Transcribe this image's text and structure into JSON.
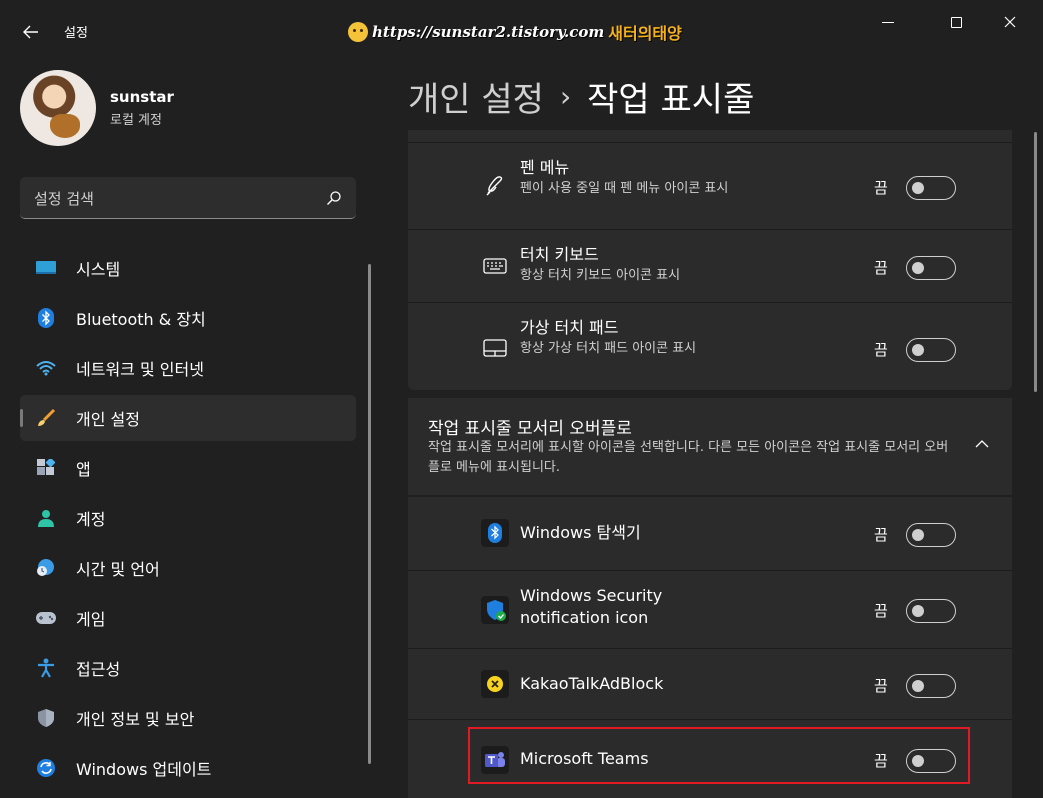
{
  "window": {
    "app_title": "설정",
    "watermark_url": "https://sunstar2.tistory.com",
    "watermark_name": "새터의태양"
  },
  "profile": {
    "name": "sunstar",
    "account_type": "로컬 계정"
  },
  "search": {
    "placeholder": "설정 검색"
  },
  "sidebar": {
    "items": [
      {
        "label": "시스템",
        "icon": "monitor-icon"
      },
      {
        "label": "Bluetooth & 장치",
        "icon": "bluetooth-icon"
      },
      {
        "label": "네트워크 및 인터넷",
        "icon": "wifi-icon"
      },
      {
        "label": "개인 설정",
        "icon": "brush-icon",
        "active": true
      },
      {
        "label": "앱",
        "icon": "apps-icon"
      },
      {
        "label": "계정",
        "icon": "person-icon"
      },
      {
        "label": "시간 및 언어",
        "icon": "globe-clock-icon"
      },
      {
        "label": "게임",
        "icon": "gamepad-icon"
      },
      {
        "label": "접근성",
        "icon": "accessibility-icon"
      },
      {
        "label": "개인 정보 및 보안",
        "icon": "shield-icon"
      },
      {
        "label": "Windows 업데이트",
        "icon": "update-icon"
      }
    ]
  },
  "breadcrumb": {
    "parent": "개인 설정",
    "separator": "›",
    "current": "작업 표시줄"
  },
  "corner_icons": [
    {
      "title": "펜 메뉴",
      "desc": "펜이 사용 중일 때 펜 메뉴 아이콘 표시",
      "state": "끔",
      "on": false,
      "icon": "pen-icon"
    },
    {
      "title": "터치 키보드",
      "desc": "항상 터치 키보드 아이콘 표시",
      "state": "끔",
      "on": false,
      "icon": "keyboard-icon"
    },
    {
      "title": "가상 터치 패드",
      "desc": "항상 가상 터치 패드 아이콘 표시",
      "state": "끔",
      "on": false,
      "icon": "touchpad-icon"
    }
  ],
  "overflow_group": {
    "title": "작업 표시줄 모서리 오버플로",
    "desc": "작업 표시줄 모서리에 표시할 아이콘을 선택합니다. 다른 모든 아이콘은 작업 표시줄 모서리 오버플로 메뉴에 표시됩니다.",
    "expanded": true
  },
  "overflow_items": [
    {
      "title": "Windows 탐색기",
      "state": "끔",
      "on": false,
      "icon": "bluetooth-app-icon"
    },
    {
      "title": "Windows Security notification icon",
      "state": "끔",
      "on": false,
      "icon": "security-shield-icon"
    },
    {
      "title": "KakaoTalkAdBlock",
      "state": "끔",
      "on": false,
      "icon": "kakao-adblock-icon"
    },
    {
      "title": "Microsoft Teams",
      "state": "끔",
      "on": false,
      "icon": "teams-icon",
      "highlighted": true
    }
  ],
  "colors": {
    "background": "#202020",
    "card": "#2b2b2b",
    "highlight_border": "#e01b24",
    "accent_bluetooth": "#3b8ef0"
  }
}
